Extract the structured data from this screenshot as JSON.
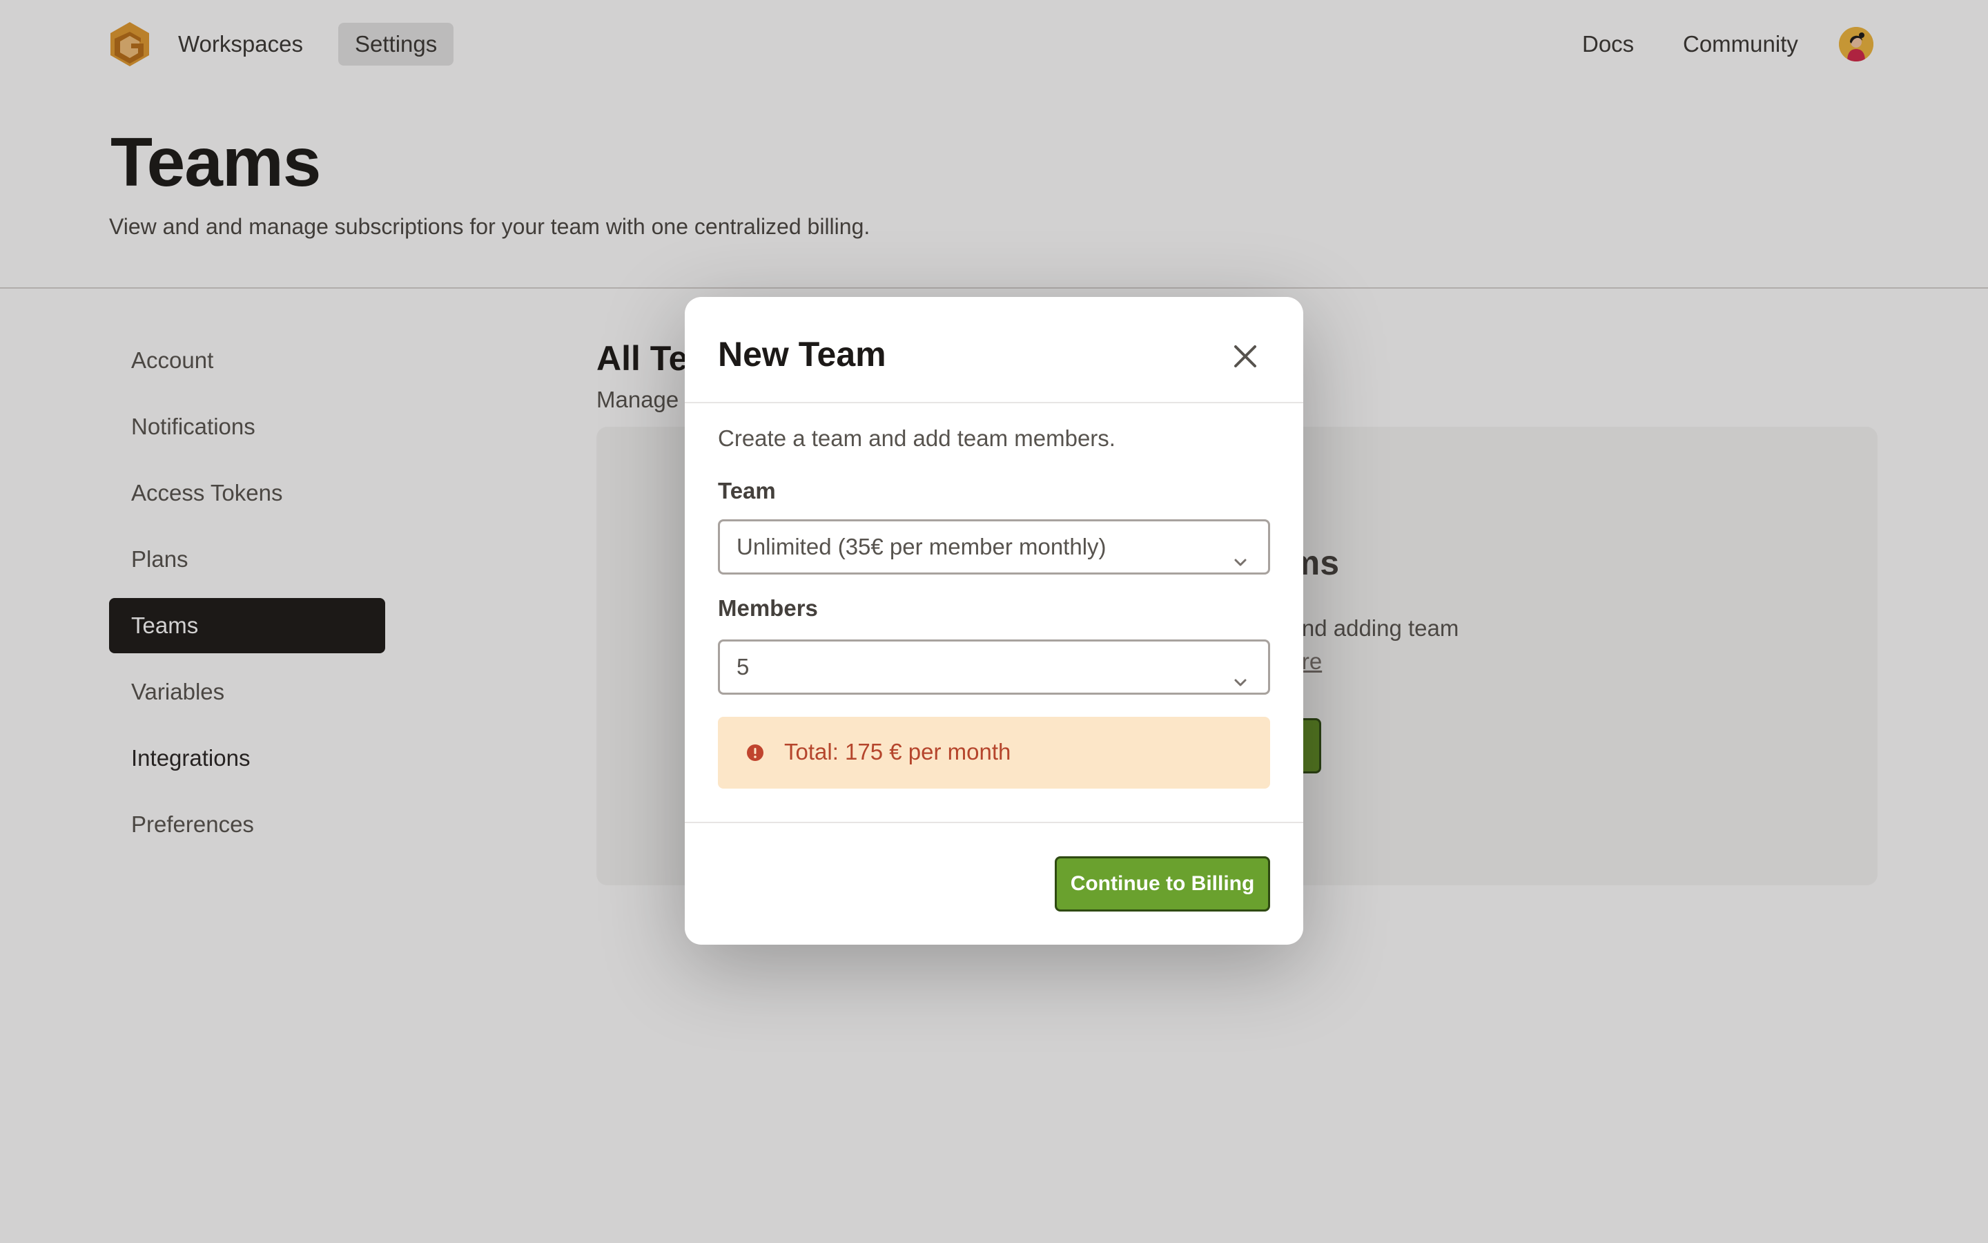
{
  "header": {
    "nav": {
      "workspaces": "Workspaces",
      "settings": "Settings",
      "docs": "Docs",
      "community": "Community"
    },
    "logo_icon": "brand-logo-icon",
    "avatar_icon": "user-avatar"
  },
  "page": {
    "title": "Teams",
    "subtitle": "View and and manage subscriptions for your team with one centralized billing."
  },
  "sidebar": {
    "items": [
      {
        "label": "Account",
        "active": false
      },
      {
        "label": "Notifications",
        "active": false
      },
      {
        "label": "Access Tokens",
        "active": false
      },
      {
        "label": "Plans",
        "active": false
      },
      {
        "label": "Teams",
        "active": true
      },
      {
        "label": "Variables",
        "active": false
      },
      {
        "label": "Integrations",
        "active": false
      },
      {
        "label": "Preferences",
        "active": false
      }
    ]
  },
  "main": {
    "title_partial": "All Te",
    "subtitle_partial": "Manage",
    "empty_title_partial": "ams",
    "empty_desc_partial": "n and adding team",
    "empty_link_partial": "more"
  },
  "modal": {
    "title": "New Team",
    "close_icon": "close-icon",
    "description": "Create a team and add team members.",
    "team_label": "Team",
    "team_value": "Unlimited (35€ per member monthly)",
    "members_label": "Members",
    "members_value": "5",
    "alert_text": "Total: 175 € per month",
    "alert_icon": "exclamation-circle-icon",
    "primary_button": "Continue to Billing"
  },
  "colors": {
    "primary": "#6aa12e",
    "alert_bg": "#fce6c8",
    "alert_text": "#b5452c",
    "sidebar_active": "#1c1917",
    "logo": "#e29a2f"
  }
}
